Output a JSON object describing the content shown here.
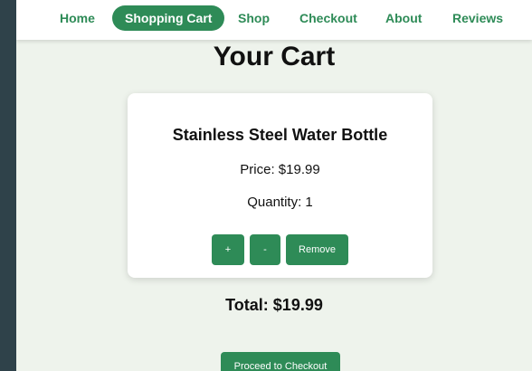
{
  "nav": {
    "items": [
      {
        "label": "Home",
        "active": false
      },
      {
        "label": "Shopping Cart",
        "active": true
      },
      {
        "label": "Shop",
        "active": false
      },
      {
        "label": "Checkout",
        "active": false
      },
      {
        "label": "About",
        "active": false
      },
      {
        "label": "Reviews",
        "active": false
      }
    ]
  },
  "page": {
    "title": "Your Cart"
  },
  "cart": {
    "items": [
      {
        "name": "Stainless Steel Water Bottle",
        "price_text": "Price: $19.99",
        "quantity_text": "Quantity: 1",
        "increase_label": "+",
        "decrease_label": "-",
        "remove_label": "Remove"
      }
    ],
    "total_text": "Total: $19.99",
    "checkout_label": "Proceed to Checkout"
  },
  "colors": {
    "accent": "#2e8b57",
    "page_background": "#eef3ec",
    "outer_background": "#2f424a"
  }
}
